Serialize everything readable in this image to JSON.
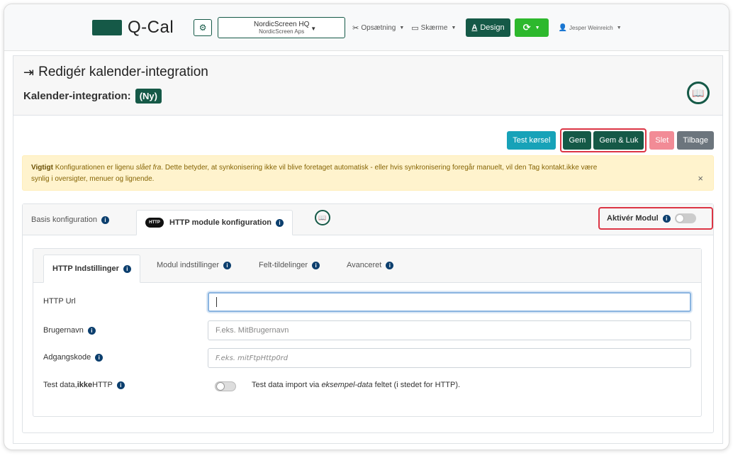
{
  "nav": {
    "logo_text": "Q-Cal",
    "org_name": "NordicScreen HQ",
    "org_sub": "NordicScreen Aps",
    "setup_label": "Opsætning",
    "screens_label": "Skærme",
    "design_label": "Design",
    "user_label": "Jesper Weinreich"
  },
  "header": {
    "title": "Redigér kalender-integration",
    "subtitle": "Kalender-integration:",
    "badge": "(Ny)"
  },
  "toolbar": {
    "test_label": "Test kørsel",
    "save_label": "Gem",
    "save_close_label": "Gem & Luk",
    "delete_label": "Slet",
    "back_label": "Tilbage"
  },
  "alert": {
    "strong": "Vigtigt",
    "text1": " Konfigurationen er ligenu ",
    "em": "slået fra",
    "text2": ". Dette betyder, at synkonisering ikke vil blive foretaget automatisk - eller hvis synkronisering foregår manuelt, vil den Tag kontakt.ikke være",
    "text3": "synlig i oversigter, menuer og lignende.",
    "close": "×"
  },
  "outer_tabs": {
    "basis": "Basis konfiguration",
    "http": "HTTP module konfiguration",
    "http_icon_text": "HTTP",
    "activate_label": "Aktivér Modul"
  },
  "inner_tabs": {
    "http": "HTTP Indstillinger",
    "modul": "Modul indstillinger",
    "felt": "Felt-tildelinger",
    "avanceret": "Avanceret"
  },
  "form": {
    "url_label": "HTTP Url",
    "url_value": "",
    "user_label": "Brugernavn",
    "user_placeholder": "F.eks. MitBrugernavn",
    "pass_label": "Adgangskode",
    "pass_placeholder": "F.eks. mitFtpHttp0rd",
    "test_label_pre": "Test data, ",
    "test_label_bold": "ikke",
    "test_label_post": " HTTP",
    "test_text_pre": "Test data import via ",
    "test_text_em": "eksempel-data",
    "test_text_post": " feltet (i stedet for HTTP)."
  },
  "colors": {
    "brand": "#155947",
    "accent_green": "#2db82d",
    "info_teal": "#17a2b8",
    "highlight_red": "#dc3545"
  }
}
